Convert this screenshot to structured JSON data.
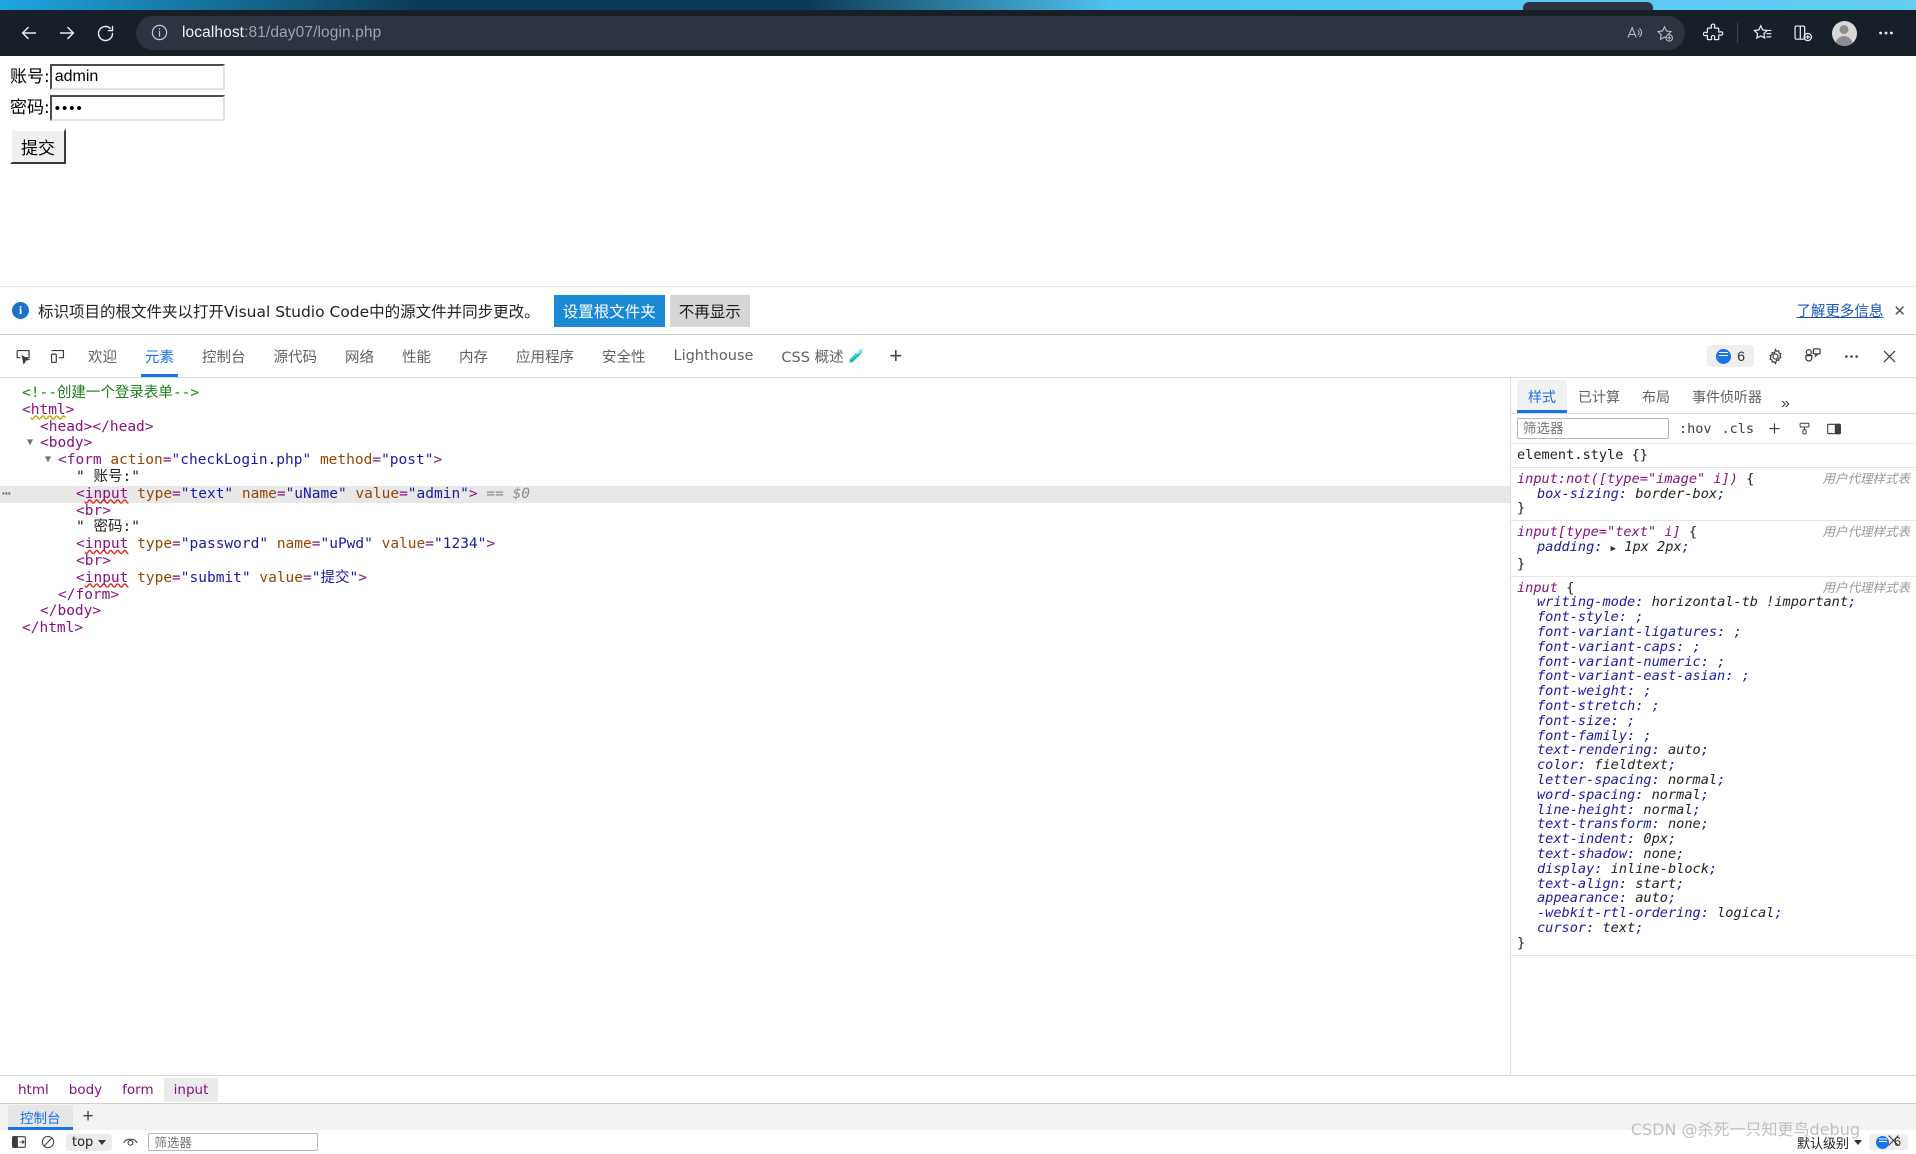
{
  "browser": {
    "url_host": "localhost",
    "url_rest": ":81/day07/login.php",
    "back_icon": "back-arrow-icon",
    "forward_icon": "forward-arrow-icon",
    "reload_icon": "reload-icon",
    "info_icon": "site-info-icon",
    "read_aloud_icon": "read-aloud-icon",
    "favorite_icon": "add-favorite-icon",
    "extensions_icon": "extensions-icon",
    "collections_icon": "collections-icon",
    "split_screen_icon": "split-screen-icon",
    "profile_icon": "profile-avatar-icon",
    "settings_icon": "settings-more-icon"
  },
  "page": {
    "username_label": "账号:",
    "username_value": "admin",
    "password_label": "密码:",
    "password_value": "1234",
    "password_masked": "••••",
    "submit_label": "提交"
  },
  "notification": {
    "info_icon": "info-icon",
    "message": "标识项目的根文件夹以打开Visual Studio Code中的源文件并同步更改。",
    "primary_button": "设置根文件夹",
    "secondary_button": "不再显示",
    "learn_more": "了解更多信息",
    "close_icon": "close-icon"
  },
  "devtools": {
    "inspect_icon": "inspect-element-icon",
    "device_icon": "device-toolbar-icon",
    "tabs": [
      {
        "label": "欢迎",
        "active": false
      },
      {
        "label": "元素",
        "active": true
      },
      {
        "label": "控制台",
        "active": false
      },
      {
        "label": "源代码",
        "active": false
      },
      {
        "label": "网络",
        "active": false
      },
      {
        "label": "性能",
        "active": false
      },
      {
        "label": "内存",
        "active": false
      },
      {
        "label": "应用程序",
        "active": false
      },
      {
        "label": "安全性",
        "active": false
      },
      {
        "label": "Lighthouse",
        "active": false
      },
      {
        "label": "CSS 概述",
        "active": false,
        "badge": "🧪"
      }
    ],
    "add_tab_icon": "add-panel-icon",
    "issues_count": "6",
    "issues_icon": "issues-bubble-icon",
    "gear_icon": "settings-gear-icon",
    "customize_icon": "customize-devtools-icon",
    "more_icon": "more-options-icon",
    "close_icon": "close-devtools-icon",
    "breadcrumb": [
      "html",
      "body",
      "form",
      "input"
    ],
    "breadcrumb_active": "input"
  },
  "dom_tree": [
    {
      "indent": 0,
      "type": "comment",
      "text": "<!--创建一个登录表单-->"
    },
    {
      "indent": 0,
      "type": "tag",
      "text": "<html>"
    },
    {
      "indent": 1,
      "type": "tag",
      "text": "<head></head>"
    },
    {
      "indent": 1,
      "type": "tag",
      "text": "<body>",
      "twisty": true
    },
    {
      "indent": 2,
      "type": "tag",
      "text": "<form action=\"checkLogin.php\" method=\"post\">",
      "twisty": true
    },
    {
      "indent": 3,
      "type": "text",
      "text": "\" 账号:\""
    },
    {
      "indent": 3,
      "type": "tag",
      "text": "<input type=\"text\" name=\"uName\" value=\"admin\">",
      "selected": true,
      "suffix": "== $0"
    },
    {
      "indent": 3,
      "type": "tag",
      "text": "<br>"
    },
    {
      "indent": 3,
      "type": "text",
      "text": "\" 密码:\""
    },
    {
      "indent": 3,
      "type": "tag",
      "text": "<input type=\"password\" name=\"uPwd\" value=\"1234\">"
    },
    {
      "indent": 3,
      "type": "tag",
      "text": "<br>"
    },
    {
      "indent": 3,
      "type": "tag",
      "text": "<input type=\"submit\" value=\"提交\">"
    },
    {
      "indent": 2,
      "type": "tag",
      "text": "</form>"
    },
    {
      "indent": 1,
      "type": "tag",
      "text": "</body>"
    },
    {
      "indent": 0,
      "type": "tag",
      "text": "</html>"
    }
  ],
  "styles_pane": {
    "tabs": [
      {
        "label": "样式",
        "active": true
      },
      {
        "label": "已计算",
        "active": false
      },
      {
        "label": "布局",
        "active": false
      },
      {
        "label": "事件侦听器",
        "active": false
      }
    ],
    "more_tabs_icon": "chevron-double-right-icon",
    "filter_placeholder": "筛选器",
    "hov_label": ":hov",
    "cls_label": ".cls",
    "new_rule_icon": "new-style-rule-icon",
    "class_icon": "element-classes-icon",
    "layout_icon": "toggle-sidebar-icon",
    "origin_label": "用户代理样式表",
    "rules": [
      {
        "selector": "element.style",
        "origin": "",
        "declarations": []
      },
      {
        "selector": "input:not([type=\"image\" i])",
        "origin": "用户代理样式表",
        "declarations": [
          {
            "name": "box-sizing",
            "value": "border-box"
          }
        ]
      },
      {
        "selector": "input[type=\"text\" i]",
        "origin": "用户代理样式表",
        "declarations": [
          {
            "name": "padding",
            "value": "1px 2px",
            "expandable": true
          }
        ]
      },
      {
        "selector": "input",
        "origin": "用户代理样式表",
        "declarations": [
          {
            "name": "writing-mode",
            "value": "horizontal-tb !important"
          },
          {
            "name": "font-style",
            "value": ""
          },
          {
            "name": "font-variant-ligatures",
            "value": ""
          },
          {
            "name": "font-variant-caps",
            "value": ""
          },
          {
            "name": "font-variant-numeric",
            "value": ""
          },
          {
            "name": "font-variant-east-asian",
            "value": ""
          },
          {
            "name": "font-weight",
            "value": ""
          },
          {
            "name": "font-stretch",
            "value": ""
          },
          {
            "name": "font-size",
            "value": ""
          },
          {
            "name": "font-family",
            "value": ""
          },
          {
            "name": "text-rendering",
            "value": "auto"
          },
          {
            "name": "color",
            "value": "fieldtext"
          },
          {
            "name": "letter-spacing",
            "value": "normal"
          },
          {
            "name": "word-spacing",
            "value": "normal"
          },
          {
            "name": "line-height",
            "value": "normal"
          },
          {
            "name": "text-transform",
            "value": "none"
          },
          {
            "name": "text-indent",
            "value": "0px"
          },
          {
            "name": "text-shadow",
            "value": "none"
          },
          {
            "name": "display",
            "value": "inline-block"
          },
          {
            "name": "text-align",
            "value": "start"
          },
          {
            "name": "appearance",
            "value": "auto"
          },
          {
            "name": "-webkit-rtl-ordering",
            "value": "logical"
          },
          {
            "name": "cursor",
            "value": "text"
          }
        ]
      }
    ]
  },
  "console_drawer": {
    "tab_label": "控制台",
    "add_icon": "add-drawer-tool-icon",
    "clear_icon": "clear-console-icon",
    "sidebar_icon": "console-sidebar-icon",
    "context_value": "top",
    "eye_icon": "live-expression-icon",
    "filter_placeholder": "筛选器",
    "level_label": "默认级别",
    "issues_count": "6",
    "close_icon": "close-drawer-icon"
  },
  "watermark": "CSDN @杀死一只知更鸟debug",
  "colors": {
    "accent_blue": "#1a73e8",
    "chrome_bg": "#172029",
    "notify_blue": "#1b8ad6"
  }
}
